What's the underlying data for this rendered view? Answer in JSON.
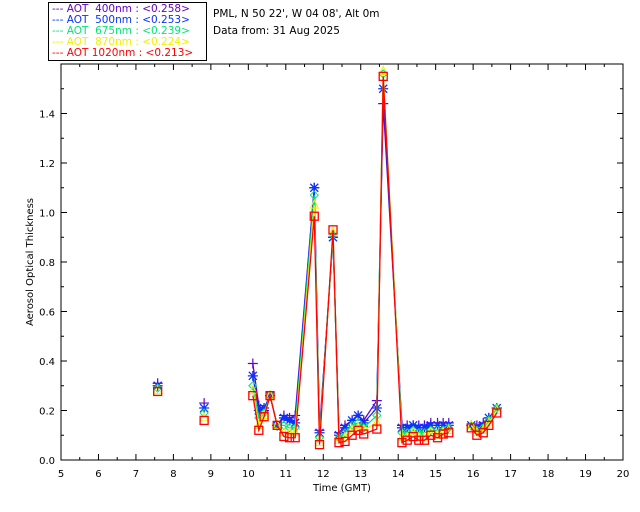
{
  "header": {
    "site": "PML, N 50 22', W 04 08', Alt 0m",
    "date": "Data from: 31 Aug 2025"
  },
  "chart_data": {
    "type": "scatter",
    "xlabel": "Time (GMT)",
    "ylabel": "Aerosol Optical Thickness",
    "xlim": [
      5,
      20
    ],
    "ylim": [
      0,
      1.6
    ],
    "xticks": [
      5,
      6,
      7,
      8,
      9,
      10,
      11,
      12,
      13,
      14,
      15,
      16,
      17,
      18,
      19,
      20
    ],
    "yticks": [
      "0.0",
      "0.2",
      "0.4",
      "0.6",
      "0.8",
      "1.0",
      "1.2",
      "1.4"
    ],
    "grid": false,
    "legend_position": "top-left, outside plot",
    "x": [
      7.58,
      8.82,
      10.12,
      10.28,
      10.42,
      10.58,
      10.77,
      10.95,
      11.1,
      11.25,
      11.76,
      11.9,
      12.26,
      12.42,
      12.58,
      12.77,
      12.93,
      13.08,
      13.43,
      13.6,
      14.1,
      14.24,
      14.4,
      14.55,
      14.7,
      14.87,
      15.05,
      15.2,
      15.35,
      15.95,
      16.1,
      16.27,
      16.42,
      16.63
    ],
    "series": [
      {
        "name": "AOT  400nm : <0.258>",
        "color": "#6a00c8",
        "marker": "plus",
        "values": [
          0.31,
          0.23,
          0.39,
          0.22,
          0.2,
          0.26,
          0.14,
          0.18,
          0.17,
          0.18,
          1.1,
          0.12,
          0.9,
          0.11,
          0.14,
          0.16,
          0.18,
          0.16,
          0.24,
          1.44,
          0.14,
          0.14,
          0.14,
          0.14,
          0.14,
          0.15,
          0.15,
          0.15,
          0.15,
          0.14,
          0.14,
          0.15,
          0.17,
          0.21
        ]
      },
      {
        "name": "AOT  500nm : <0.253>",
        "color": "#0a32ff",
        "marker": "asterisk",
        "values": [
          0.3,
          0.21,
          0.34,
          0.2,
          0.21,
          0.26,
          0.14,
          0.17,
          0.16,
          0.15,
          1.1,
          0.11,
          0.9,
          0.1,
          0.13,
          0.16,
          0.18,
          0.15,
          0.21,
          1.5,
          0.13,
          0.13,
          0.14,
          0.13,
          0.13,
          0.14,
          0.14,
          0.14,
          0.14,
          0.14,
          0.13,
          0.14,
          0.17,
          0.21
        ]
      },
      {
        "name": "AOT  675nm : <0.239>",
        "color": "#00e676",
        "marker": "diamond",
        "values": [
          0.29,
          0.19,
          0.3,
          0.17,
          0.19,
          0.26,
          0.14,
          0.14,
          0.13,
          0.13,
          1.07,
          0.09,
          0.91,
          0.09,
          0.11,
          0.14,
          0.15,
          0.13,
          0.18,
          1.56,
          0.11,
          0.11,
          0.12,
          0.11,
          0.11,
          0.12,
          0.12,
          0.12,
          0.13,
          0.14,
          0.12,
          0.13,
          0.16,
          0.21
        ]
      },
      {
        "name": "AOT  870nm : <0.224>",
        "color": "#f0f000",
        "marker": "triangle",
        "values": [
          0.28,
          0.17,
          0.28,
          0.14,
          0.18,
          0.26,
          0.14,
          0.11,
          0.11,
          0.11,
          1.03,
          0.07,
          0.92,
          0.08,
          0.09,
          0.12,
          0.13,
          0.12,
          0.15,
          1.57,
          0.09,
          0.09,
          0.11,
          0.09,
          0.09,
          0.11,
          0.1,
          0.11,
          0.12,
          0.14,
          0.11,
          0.12,
          0.15,
          0.2
        ]
      },
      {
        "name": "AOT 1020nm : <0.213>",
        "color": "#ff0000",
        "marker": "square",
        "values": [
          0.277,
          0.16,
          0.26,
          0.12,
          0.175,
          0.26,
          0.14,
          0.095,
          0.09,
          0.09,
          0.985,
          0.062,
          0.93,
          0.07,
          0.075,
          0.1,
          0.12,
          0.105,
          0.125,
          1.55,
          0.07,
          0.08,
          0.095,
          0.08,
          0.08,
          0.1,
          0.09,
          0.105,
          0.11,
          0.13,
          0.1,
          0.11,
          0.14,
          0.19
        ]
      }
    ]
  }
}
